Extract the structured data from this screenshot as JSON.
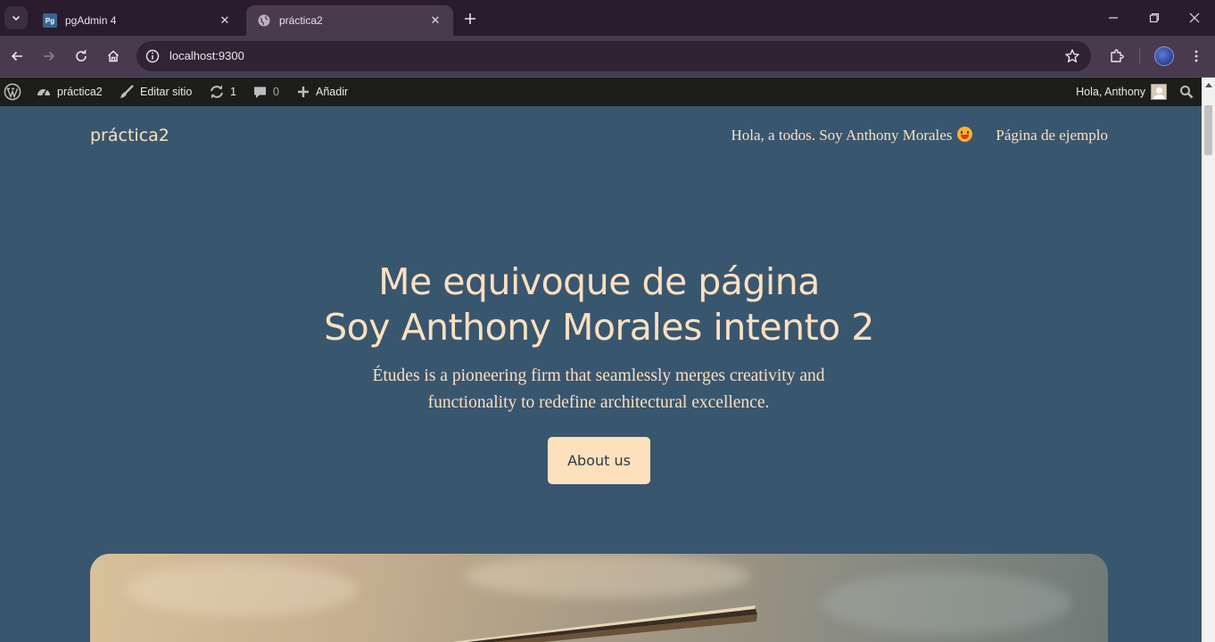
{
  "browser": {
    "tabs": [
      {
        "title": "pgAdmin 4",
        "favicon": "pgadmin-icon",
        "active": false
      },
      {
        "title": "práctica2",
        "favicon": "globe-icon",
        "active": true
      }
    ],
    "address": "localhost:9300"
  },
  "adminbar": {
    "site_name": "práctica2",
    "edit_site": "Editar sitio",
    "updates_count": "1",
    "comments_count": "0",
    "add_new": "Añadir",
    "greeting": "Hola, Anthony"
  },
  "site": {
    "title": "práctica2",
    "nav": [
      {
        "label": "Hola, a todos. Soy Anthony Morales"
      },
      {
        "label": "Página de ejemplo"
      }
    ]
  },
  "hero": {
    "title_line1": "Me equivoque de página",
    "title_line2": "Soy Anthony Morales intento 2",
    "text": "Études is a pioneering firm that seamlessly merges creativity and functionality to redefine architectural excellence.",
    "button": "About us"
  },
  "colors": {
    "page_bg": "#39566f",
    "accent_text": "#fbe0c0",
    "button_bg": "#fde0bc",
    "adminbar_bg": "#1d1d1b",
    "tabstrip_bg": "#2a1c2e",
    "toolbar_bg": "#4a3a4e"
  }
}
